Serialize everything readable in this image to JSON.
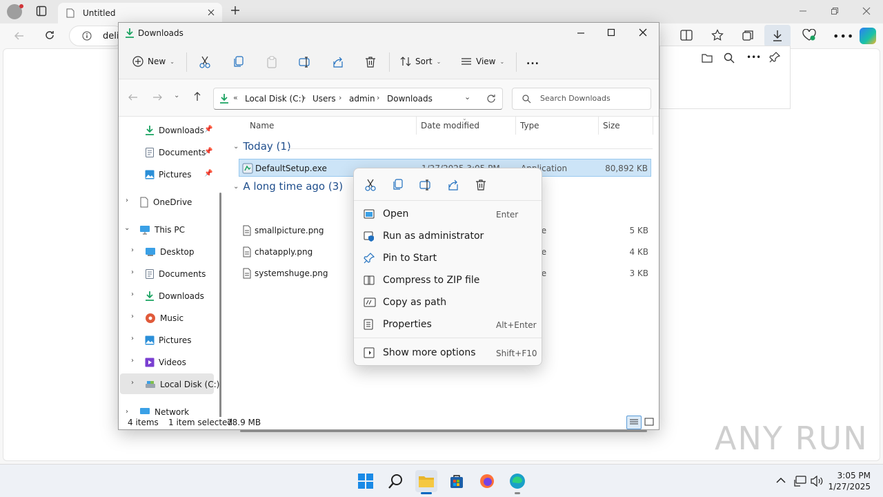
{
  "browser": {
    "tab_title": "Untitled",
    "address_text": "deli"
  },
  "explorer": {
    "title": "Downloads",
    "toolbar": {
      "new_label": "New",
      "sort_label": "Sort",
      "view_label": "View",
      "more_label": "..."
    },
    "breadcrumb": [
      "Local Disk (C:)",
      "Users",
      "admin",
      "Downloads"
    ],
    "search_placeholder": "Search Downloads",
    "nav": {
      "quick": [
        {
          "label": "Downloads"
        },
        {
          "label": "Documents"
        },
        {
          "label": "Pictures"
        }
      ],
      "onedrive": "OneDrive",
      "thispc": "This PC",
      "pc_items": [
        {
          "label": "Desktop"
        },
        {
          "label": "Documents"
        },
        {
          "label": "Downloads"
        },
        {
          "label": "Music"
        },
        {
          "label": "Pictures"
        },
        {
          "label": "Videos"
        },
        {
          "label": "Local Disk (C:)"
        }
      ],
      "network": "Network"
    },
    "columns": {
      "name": "Name",
      "date": "Date modified",
      "type": "Type",
      "size": "Size"
    },
    "groups": {
      "today": "Today (1)",
      "older": "A long time ago (3)"
    },
    "files_today": [
      {
        "name": "DefaultSetup.exe",
        "date": "1/27/2025 3:05 PM",
        "type": "Application",
        "size": "80,892 KB"
      }
    ],
    "files_older": [
      {
        "name": "smallpicture.png",
        "type": "File",
        "size": "5 KB"
      },
      {
        "name": "chatapply.png",
        "type": "File",
        "size": "4 KB"
      },
      {
        "name": "systemshuge.png",
        "type": "File",
        "size": "3 KB"
      }
    ],
    "status": {
      "items": "4 items",
      "selected": "1 item selected",
      "size": "78.9 MB"
    }
  },
  "context_menu": {
    "items": [
      {
        "label": "Open",
        "shortcut": "Enter"
      },
      {
        "label": "Run as administrator",
        "shortcut": ""
      },
      {
        "label": "Pin to Start",
        "shortcut": ""
      },
      {
        "label": "Compress to ZIP file",
        "shortcut": ""
      },
      {
        "label": "Copy as path",
        "shortcut": ""
      },
      {
        "label": "Properties",
        "shortcut": "Alt+Enter"
      },
      {
        "label": "Show more options",
        "shortcut": "Shift+F10"
      }
    ]
  },
  "taskbar": {
    "time": "3:05 PM",
    "date": "1/27/2025"
  },
  "watermark": "ANY RUN",
  "colors": {
    "accent": "#0067c0",
    "selection": "#cce4f7",
    "folder": "#e8b52c",
    "green": "#1aa260"
  }
}
